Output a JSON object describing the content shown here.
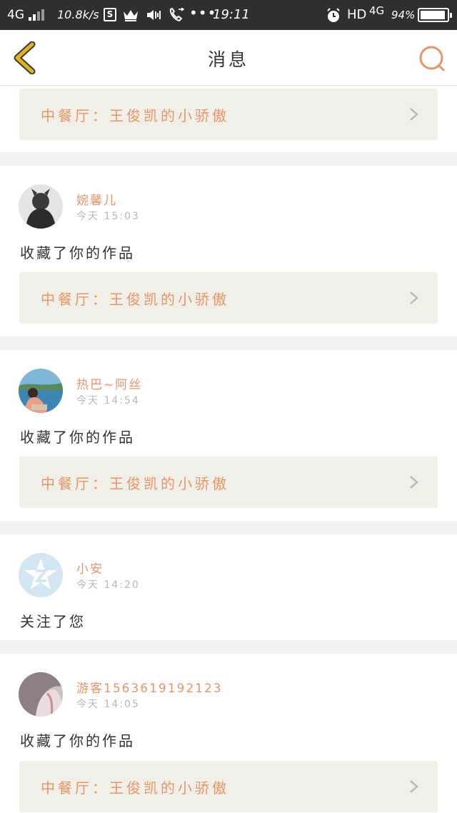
{
  "status_bar": {
    "network": "4G",
    "speed": "10.8k/s",
    "s_badge": "S",
    "dots": "•••",
    "time": "19:11",
    "hd": "HD",
    "network2": "4G",
    "battery_pct": "94%",
    "battery_level": 0.94
  },
  "header": {
    "title": "消息"
  },
  "partial_item": {
    "work_title": "中餐厅：王俊凯的小骄傲"
  },
  "messages": [
    {
      "username": "婉馨儿",
      "time": "今天 15:03",
      "action": "收藏了你的作品",
      "work_title": "中餐厅：王俊凯的小骄傲"
    },
    {
      "username": "热巴~阿丝",
      "time": "今天 14:54",
      "action": "收藏了你的作品",
      "work_title": "中餐厅：王俊凯的小骄傲"
    },
    {
      "username": "小安",
      "time": "今天 14:20",
      "action": "关注了您"
    },
    {
      "username": "游客1563619192123",
      "time": "今天 14:05",
      "action": "收藏了你的作品",
      "work_title": "中餐厅：王俊凯的小骄傲"
    }
  ],
  "colors": {
    "accent": "#e8956a",
    "back_arrow": "#e3b21a",
    "status_bar": "#2f2f2f",
    "work_bg": "#f0f0e8"
  }
}
